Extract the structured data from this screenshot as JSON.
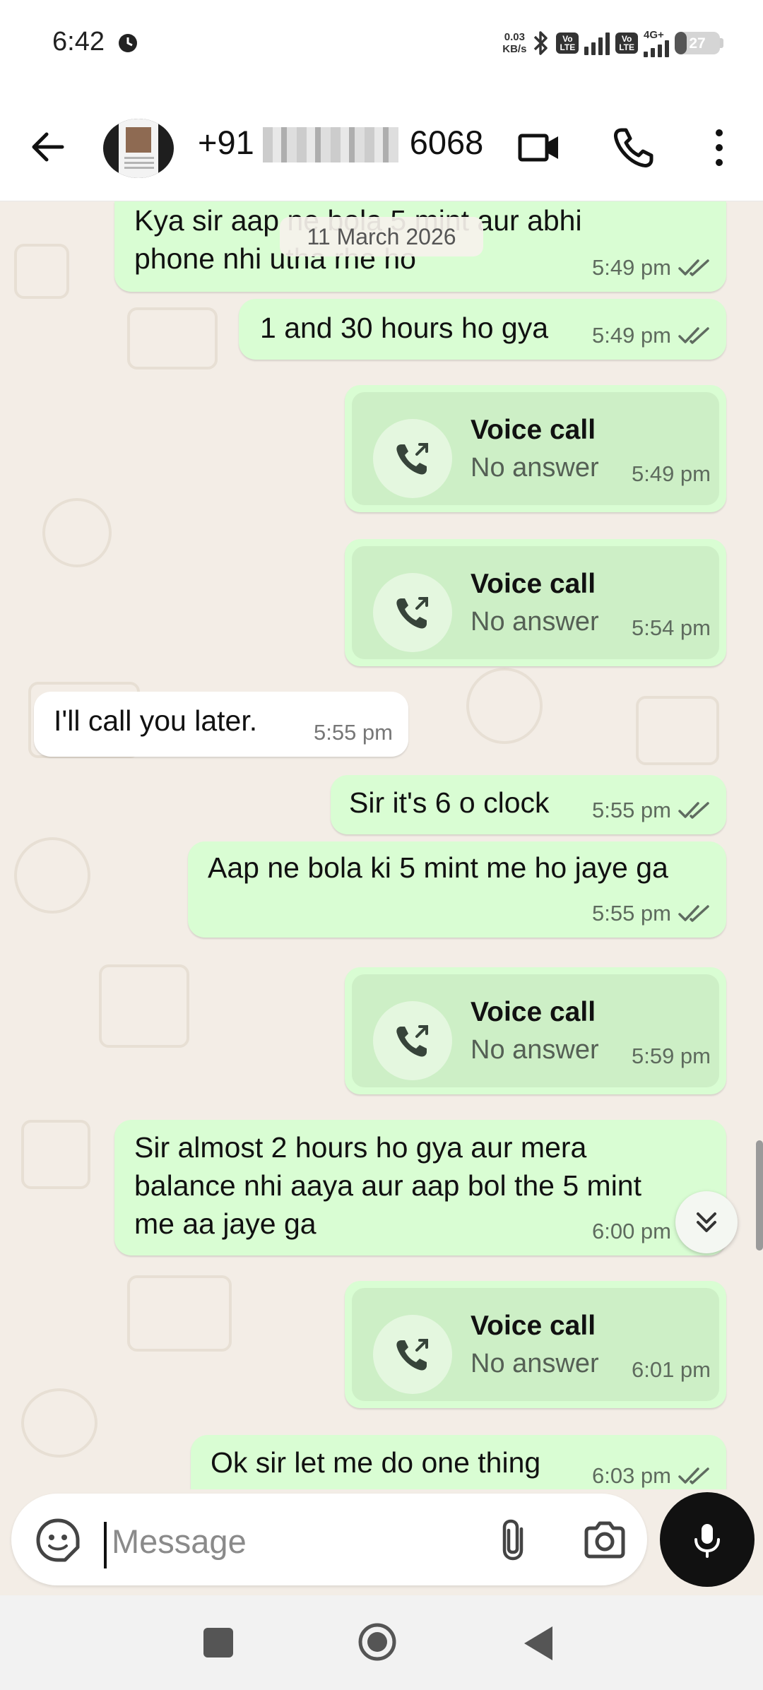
{
  "status_bar": {
    "time": "6:42",
    "net_speed_value": "0.03",
    "net_speed_unit": "KB/s",
    "sim1_label_top": "Vo",
    "sim1_label_bottom": "LTE",
    "sim2_label_top": "Vo",
    "sim2_label_bottom": "LTE",
    "network_type": "4G+",
    "battery_level": "27",
    "battery_fraction": 0.27
  },
  "header": {
    "contact_prefix": "+91",
    "contact_suffix": "6068",
    "icons": [
      "arrow-left-icon",
      "video-camera-icon",
      "phone-icon",
      "more-vertical-icon"
    ]
  },
  "chat": {
    "date_chip": "11 March 2026",
    "messages": [
      {
        "type": "text",
        "dir": "out",
        "lines": [
          "Kya sir aap ne bola 5 mint aur abhi",
          "phone nhi utha rhe ho"
        ],
        "time": "5:49 pm",
        "status": "read"
      },
      {
        "type": "text",
        "dir": "out",
        "lines": [
          "1 and 30 hours ho gya"
        ],
        "time": "5:49 pm",
        "status": "read"
      },
      {
        "type": "call",
        "dir": "out",
        "title": "Voice call",
        "subtitle": "No answer",
        "time": "5:49 pm"
      },
      {
        "type": "call",
        "dir": "out",
        "title": "Voice call",
        "subtitle": "No answer",
        "time": "5:54 pm"
      },
      {
        "type": "text",
        "dir": "in",
        "lines": [
          "I'll call you later."
        ],
        "time": "5:55 pm"
      },
      {
        "type": "text",
        "dir": "out",
        "lines": [
          "Sir it's 6 o clock"
        ],
        "time": "5:55 pm",
        "status": "read"
      },
      {
        "type": "text",
        "dir": "out",
        "lines": [
          "Aap ne bola ki 5 mint me ho jaye ga"
        ],
        "time": "5:55 pm",
        "status": "read"
      },
      {
        "type": "call",
        "dir": "out",
        "title": "Voice call",
        "subtitle": "No answer",
        "time": "5:59 pm"
      },
      {
        "type": "text",
        "dir": "out",
        "lines": [
          "Sir almost 2 hours ho gya aur mera",
          "balance nhi aaya aur aap bol the 5 mint",
          "me aa jaye ga"
        ],
        "time": "6:00 pm",
        "status": "read"
      },
      {
        "type": "call",
        "dir": "out",
        "title": "Voice call",
        "subtitle": "No answer",
        "time": "6:01 pm"
      },
      {
        "type": "text",
        "dir": "out",
        "lines": [
          "Ok sir let me do one thing"
        ],
        "time": "6:03 pm",
        "status": "read"
      }
    ]
  },
  "composer": {
    "placeholder": "Message",
    "icons": [
      "sticker-icon",
      "paperclip-icon",
      "camera-icon",
      "microphone-icon"
    ]
  },
  "colors": {
    "outgoing_bubble": "#d9fdd3",
    "incoming_bubble": "#ffffff",
    "read_ticks": "#5f6b60",
    "chat_background": "#f3ede6"
  }
}
